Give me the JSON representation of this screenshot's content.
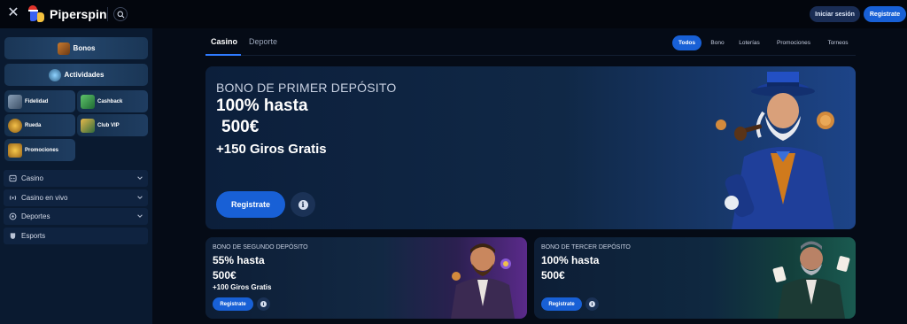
{
  "header": {
    "brand": "Piperspin",
    "login_label": "Iniciar sesión",
    "register_label": "Registrate"
  },
  "sidebar": {
    "bonos": "Bonos",
    "actividades": "Actividades",
    "fidelidad": "Fidelidad",
    "cashback": "Cashback",
    "rueda": "Rueda",
    "club_vip": "Club VIP",
    "promociones": "Promociones",
    "menu": [
      {
        "label": "Casino",
        "icon": "casino-icon",
        "expandable": true
      },
      {
        "label": "Casino en vivo",
        "icon": "live-icon",
        "expandable": true
      },
      {
        "label": "Deportes",
        "icon": "ball-icon",
        "expandable": true
      },
      {
        "label": "Esports",
        "icon": "esports-icon",
        "expandable": false
      }
    ]
  },
  "tabs": {
    "casino": "Casino",
    "deporte": "Deporte"
  },
  "filters": [
    "Todos",
    "Bono",
    "Loterías",
    "Promociones",
    "Torneos"
  ],
  "hero": {
    "subtitle": "BONO DE PRIMER DEPÓSITO",
    "line1": "100% hasta",
    "line2": "500€",
    "line3": "+150 Giros Gratis",
    "button": "Registrate"
  },
  "card2": {
    "title": "BONO DE SEGUNDO DEPÓSITO",
    "line1": "55% hasta",
    "line2": "500€",
    "line3": "+100 Giros Gratis",
    "button": "Registrate"
  },
  "card3": {
    "title": "BONO DE TERCER DEPÓSITO",
    "line1": "100% hasta",
    "line2": "500€",
    "button": "Registrate"
  },
  "colors": {
    "accent": "#1860d6",
    "sidebar_bg": "#0a1a30",
    "page_bg": "#050b16"
  }
}
